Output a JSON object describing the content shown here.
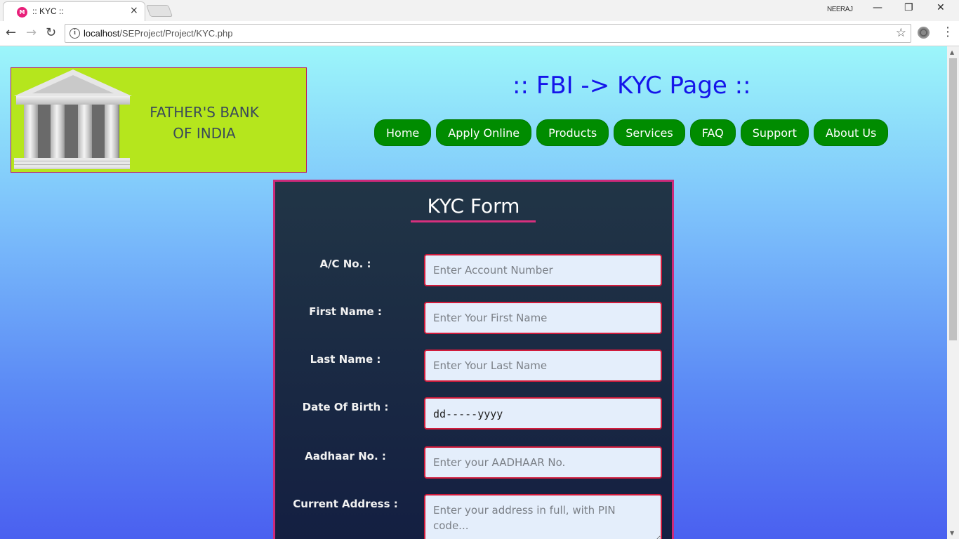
{
  "browser": {
    "tab_title": ":: KYC ::",
    "favicon_label": "M",
    "tab_close": "×",
    "profile_name": "NEERAJ",
    "window_minimize": "—",
    "window_restore": "❐",
    "window_close": "✕",
    "back": "←",
    "forward": "→",
    "reload": "↻",
    "info_icon": "i",
    "url_host": "localhost",
    "url_path": "/SEProject/Project/KYC.php",
    "bookmark_star": "☆",
    "menu": "⋮"
  },
  "logo": {
    "line1": "FATHER'S BANK",
    "line2": "OF INDIA"
  },
  "header": {
    "title": ":: FBI -> KYC Page ::"
  },
  "nav": {
    "items": [
      "Home",
      "Apply Online",
      "Products",
      "Services",
      "FAQ",
      "Support",
      "About Us"
    ]
  },
  "form": {
    "title": "KYC Form",
    "fields": [
      {
        "label": "A/C No. :",
        "placeholder": "Enter Account Number"
      },
      {
        "label": "First Name :",
        "placeholder": "Enter Your First Name"
      },
      {
        "label": "Last Name :",
        "placeholder": "Enter Your Last Name"
      },
      {
        "label": "Date Of Birth :",
        "value": "dd-----yyyy"
      },
      {
        "label": "Aadhaar No. :",
        "placeholder": "Enter your AADHAAR No."
      },
      {
        "label": "Current Address :",
        "placeholder": "Enter your address in full, with PIN code..."
      }
    ]
  },
  "colors": {
    "heading": "#1515ea",
    "nav_button": "#008c00",
    "logo_bg": "#b5e61d",
    "form_border": "#cc2a7a",
    "input_border": "#d11b3b"
  }
}
